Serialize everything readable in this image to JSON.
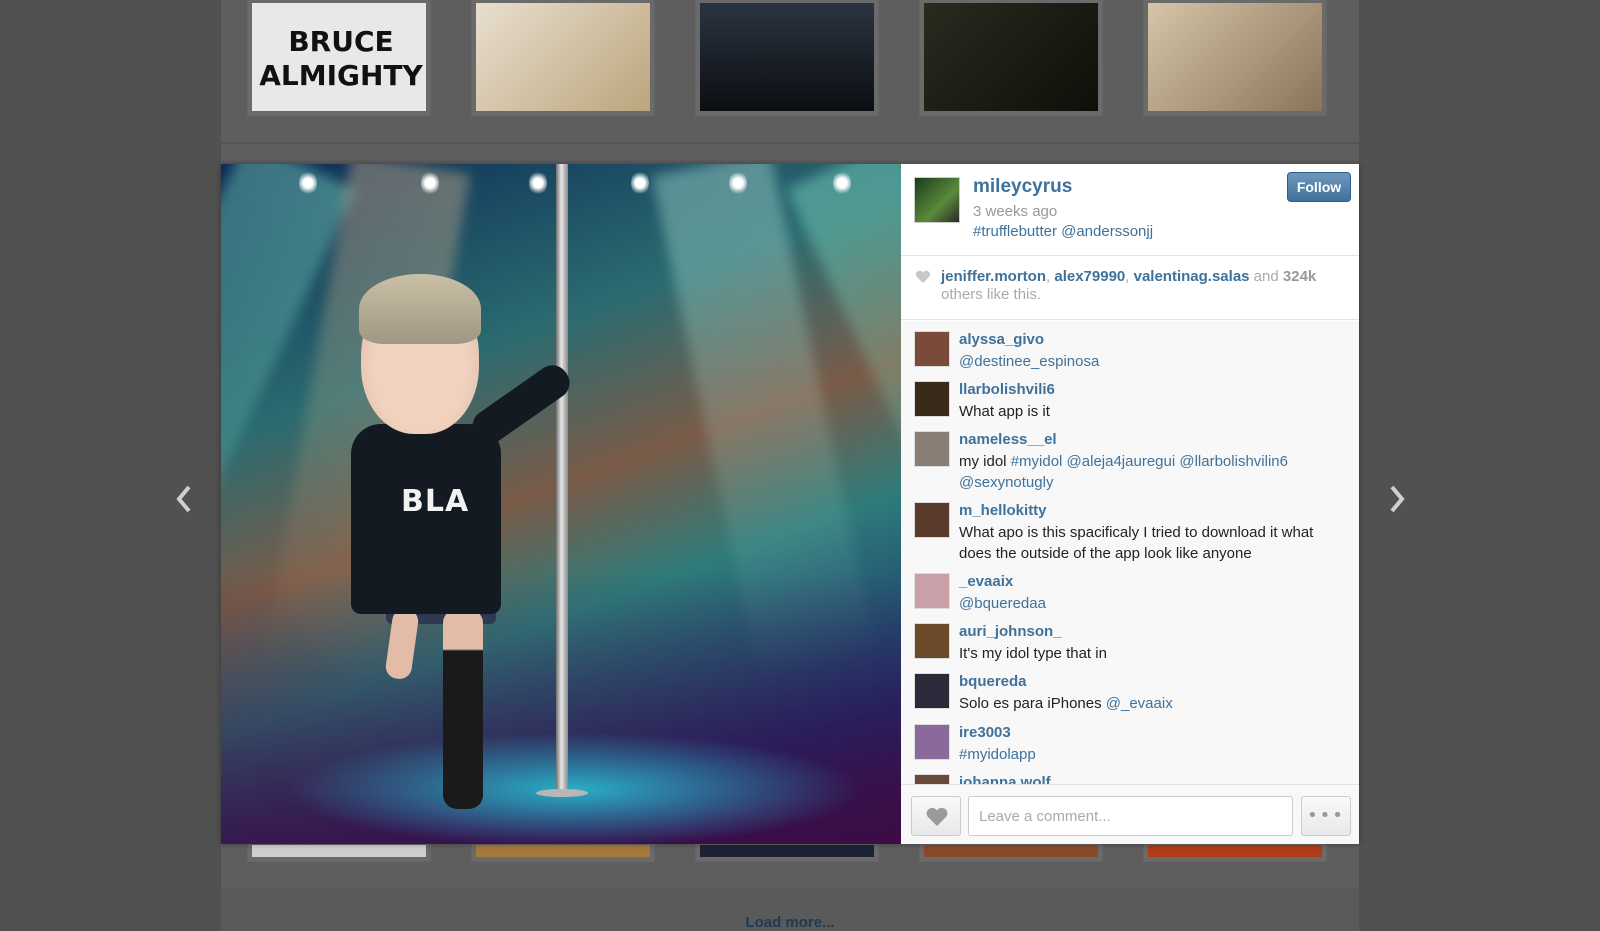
{
  "feed": {
    "top_thumbs": [
      {
        "label": "BRUCE ALMIGHTY",
        "color": "#f2f2f2"
      },
      {
        "label": "",
        "color": "#d9c9a8"
      },
      {
        "label": "",
        "color": "#1a1f26"
      },
      {
        "label": "",
        "color": "#1b1b14"
      },
      {
        "label": "",
        "color": "#bfa886"
      }
    ],
    "load_more": "Load more..."
  },
  "nav": {
    "prev_icon": "chevron-left-icon",
    "next_icon": "chevron-right-icon"
  },
  "media": {
    "shirt_text": "BLA"
  },
  "post": {
    "owner": "mileycyrus",
    "time": "3 weeks ago",
    "caption": "#trufflebutter @anderssonjj",
    "follow_label": "Follow"
  },
  "likes": {
    "users": [
      "jeniffer.morton",
      "alex79990",
      "valentinag.salas"
    ],
    "sep": ", ",
    "and": " and ",
    "count": "324k",
    "suffix": " others like this."
  },
  "comments": [
    {
      "user": "alyssa_givo",
      "text": "@destinee_espinosa",
      "avatar": "#7a4a3a"
    },
    {
      "user": "llarbolishvili6",
      "text": "What app is it",
      "avatar": "#3a2a1a"
    },
    {
      "user": "nameless__el",
      "text": "my idol #myidol @aleja4jauregui @llarbolishvilin6 @sexynotugly",
      "avatar": "#8a7e74"
    },
    {
      "user": "m_hellokitty",
      "text": "What apo is this spacificaly I tried to download it what does the outside of the app look like anyone",
      "avatar": "#5a3a2a"
    },
    {
      "user": "_evaaix",
      "text": "@bqueredaa",
      "avatar": "#c9a0a8"
    },
    {
      "user": "auri_johnson_",
      "text": "It's my idol type that in",
      "avatar": "#6b4a2a"
    },
    {
      "user": "bquereda",
      "text": "Solo es para iPhones @_evaaix",
      "avatar": "#2a2a3a"
    },
    {
      "user": "ire3003",
      "text": "#myidolapp",
      "avatar": "#8a6a9a"
    },
    {
      "user": "johanna.wolf",
      "text": "",
      "avatar": "#6a4a3a"
    }
  ],
  "footer": {
    "placeholder": "Leave a comment...",
    "more_label": "•••"
  },
  "colors": {
    "link": "#3f729b",
    "follow": "#3f729b",
    "backdrop": "#515151"
  }
}
